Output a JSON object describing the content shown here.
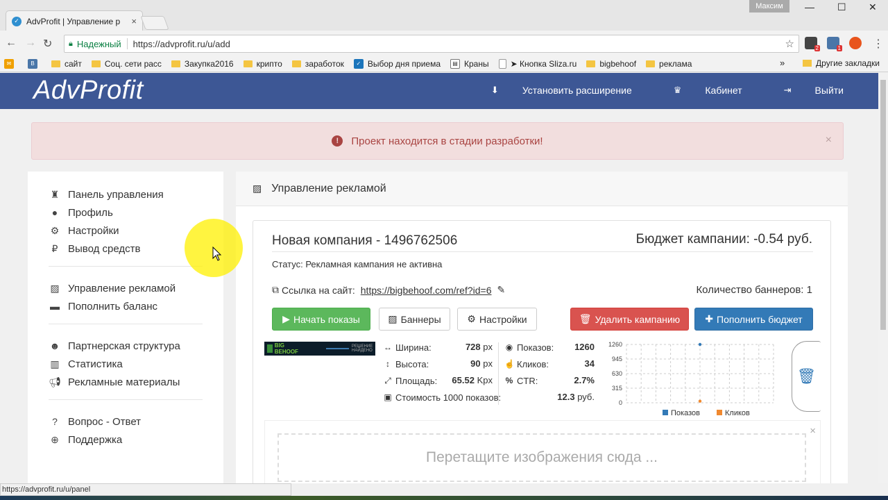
{
  "browser": {
    "tab_title": "AdvProfit | Управление р",
    "tab_close": "×",
    "user": "Максим",
    "secure_label": "Надежный",
    "url": "https://advprofit.ru/u/add",
    "status_url": "https://advprofit.ru/u/panel",
    "ext_badges": [
      "2",
      "1"
    ],
    "bookmarks": [
      {
        "label": "сайт",
        "kind": "folder"
      },
      {
        "label": "Соц. сети расс",
        "kind": "folder"
      },
      {
        "label": "Закупка2016",
        "kind": "folder"
      },
      {
        "label": "крипто",
        "kind": "folder"
      },
      {
        "label": "заработок",
        "kind": "folder"
      },
      {
        "label": "Выбор дня приема",
        "kind": "icon"
      },
      {
        "label": "Краны",
        "kind": "folder"
      },
      {
        "label": "➤ Кнопка Sliza.ru",
        "kind": "page"
      },
      {
        "label": "bigbehoof",
        "kind": "folder"
      },
      {
        "label": "реклама",
        "kind": "folder"
      }
    ],
    "more_bookmarks": "»",
    "other_bookmarks": "Другие закладки"
  },
  "site": {
    "logo": "AdvProfit",
    "nav": {
      "install": "Установить расширение",
      "cabinet": "Кабинет",
      "logout": "Выйти"
    },
    "alert": "Проект находится в стадии разработки!",
    "sidebar": {
      "group1": [
        "Панель управления",
        "Профиль",
        "Настройки",
        "Вывод средств"
      ],
      "group2": [
        "Управление рекламой",
        "Пополнить баланс"
      ],
      "group3": [
        "Партнерская структура",
        "Статистика",
        "Рекламные материалы"
      ],
      "group4": [
        "Вопрос - Ответ",
        "Поддержка"
      ]
    },
    "panel_title": "Управление рекламой",
    "campaign": {
      "title": "Новая компания - 1496762506",
      "budget": "Бюджет кампании: -0.54 руб.",
      "status": "Статус: Рекламная кампания не активна",
      "site_label": "Ссылка на сайт:",
      "site_url": "https://bigbehoof.com/ref?id=6",
      "banner_count": "Количество баннеров: 1",
      "buttons": {
        "start": "Начать показы",
        "banners": "Баннеры",
        "settings": "Настройки",
        "delete": "Удалить кампанию",
        "topup": "Пополнить бюджет"
      },
      "banner_text": "BIG BEHOOF",
      "banner_sub": "РЕШЕНИЕ НАЙДЕНО",
      "stats": {
        "width_label": "Ширина:",
        "width_value": "728",
        "width_unit": "px",
        "height_label": "Высота:",
        "height_value": "90",
        "height_unit": "px",
        "area_label": "Площадь:",
        "area_value": "65.52",
        "area_unit": "Kpx",
        "cost_label": "Стоимость 1000 показов:",
        "cost_value": "12.3",
        "cost_unit": "руб.",
        "views_label": "Показов:",
        "views_value": "1260",
        "clicks_label": "Кликов:",
        "clicks_value": "34",
        "ctr_label": "CTR:",
        "ctr_value": "2.7%"
      },
      "dropzone": "Перетащите изображения сюда ...",
      "dropzone_close": "×"
    },
    "alert_close": "×"
  },
  "chart_data": {
    "type": "scatter",
    "ylim": [
      0,
      1260
    ],
    "yticks": [
      "1260",
      "945",
      "630",
      "315",
      "0"
    ],
    "x_slots": 10,
    "series": [
      {
        "name": "Показов",
        "color": "#337ab7",
        "points": [
          {
            "x": 5,
            "y": 1260
          }
        ]
      },
      {
        "name": "Кликов",
        "color": "#f0892f",
        "points": [
          {
            "x": 5,
            "y": 34
          }
        ]
      }
    ],
    "grid": true,
    "legend": "bottom"
  }
}
